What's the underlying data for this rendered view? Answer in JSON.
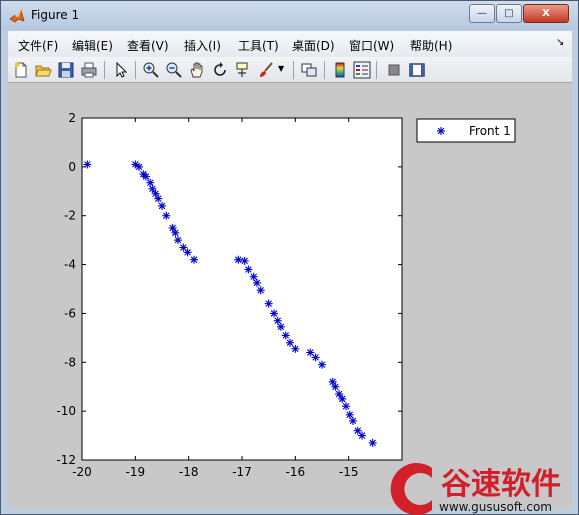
{
  "window": {
    "title": "Figure 1",
    "minimize": "—",
    "maximize": "□",
    "close": "X"
  },
  "menu": [
    {
      "label": "文件(F)"
    },
    {
      "label": "编辑(E)"
    },
    {
      "label": "查看(V)"
    },
    {
      "label": "插入(I)"
    },
    {
      "label": "工具(T)"
    },
    {
      "label": "桌面(D)"
    },
    {
      "label": "窗口(W)"
    },
    {
      "label": "帮助(H)"
    }
  ],
  "toolbar": [
    {
      "icon": "new-figure-icon"
    },
    {
      "icon": "open-folder-icon"
    },
    {
      "icon": "save-icon"
    },
    {
      "icon": "print-icon"
    },
    {
      "icon": "select-arrow-icon"
    },
    {
      "icon": "zoom-in-icon"
    },
    {
      "icon": "zoom-out-icon"
    },
    {
      "icon": "pan-hand-icon"
    },
    {
      "icon": "rotate-3d-icon"
    },
    {
      "icon": "data-cursor-icon"
    },
    {
      "icon": "brush-icon"
    },
    {
      "icon": "link-plot-icon"
    },
    {
      "icon": "colorbar-icon"
    },
    {
      "icon": "legend-icon"
    },
    {
      "icon": "hide-plot-tools-icon"
    },
    {
      "icon": "show-plot-tools-icon"
    }
  ],
  "watermark": {
    "brand": "谷速软件",
    "url": "www.gususoft.com",
    "color": "#d2202a"
  },
  "chart_data": {
    "type": "scatter",
    "title": "",
    "xlabel": "",
    "ylabel": "",
    "xlim": [
      -20,
      -14
    ],
    "ylim": [
      -12,
      2
    ],
    "xticks": [
      -20,
      -19,
      -18,
      -17,
      -16,
      -15,
      -14
    ],
    "yticks": [
      2,
      0,
      -2,
      -4,
      -6,
      -8,
      -10,
      -12
    ],
    "tick_labels_x": [
      "-20",
      "-19",
      "-18",
      "-17",
      "-16",
      "-15"
    ],
    "tick_labels_y": [
      "2",
      "0",
      "-2",
      "-4",
      "-6",
      "-8",
      "-10",
      "-12"
    ],
    "grid": false,
    "legend_placement": "outside-right",
    "marker": "asterisk",
    "series": [
      {
        "name": "Front 1",
        "color": "#0000cc",
        "points": [
          [
            -19.9,
            0.1
          ],
          [
            -19.0,
            0.1
          ],
          [
            -18.93,
            0.0
          ],
          [
            -18.85,
            -0.3
          ],
          [
            -18.8,
            -0.4
          ],
          [
            -18.72,
            -0.65
          ],
          [
            -18.68,
            -0.9
          ],
          [
            -18.62,
            -1.1
          ],
          [
            -18.57,
            -1.3
          ],
          [
            -18.5,
            -1.6
          ],
          [
            -18.42,
            -2.0
          ],
          [
            -18.3,
            -2.5
          ],
          [
            -18.25,
            -2.7
          ],
          [
            -18.2,
            -3.0
          ],
          [
            -18.1,
            -3.3
          ],
          [
            -18.02,
            -3.5
          ],
          [
            -17.9,
            -3.8
          ],
          [
            -17.07,
            -3.8
          ],
          [
            -16.95,
            -3.85
          ],
          [
            -16.88,
            -4.2
          ],
          [
            -16.78,
            -4.5
          ],
          [
            -16.72,
            -4.75
          ],
          [
            -16.65,
            -5.05
          ],
          [
            -16.5,
            -5.6
          ],
          [
            -16.4,
            -6.0
          ],
          [
            -16.33,
            -6.3
          ],
          [
            -16.27,
            -6.55
          ],
          [
            -16.18,
            -6.9
          ],
          [
            -16.1,
            -7.2
          ],
          [
            -16.0,
            -7.45
          ],
          [
            -15.72,
            -7.6
          ],
          [
            -15.62,
            -7.8
          ],
          [
            -15.5,
            -8.1
          ],
          [
            -15.3,
            -8.8
          ],
          [
            -15.25,
            -9.0
          ],
          [
            -15.18,
            -9.3
          ],
          [
            -15.12,
            -9.5
          ],
          [
            -15.05,
            -9.8
          ],
          [
            -14.98,
            -10.15
          ],
          [
            -14.92,
            -10.4
          ],
          [
            -14.83,
            -10.8
          ],
          [
            -14.75,
            -11.0
          ],
          [
            -14.55,
            -11.3
          ]
        ]
      }
    ]
  }
}
